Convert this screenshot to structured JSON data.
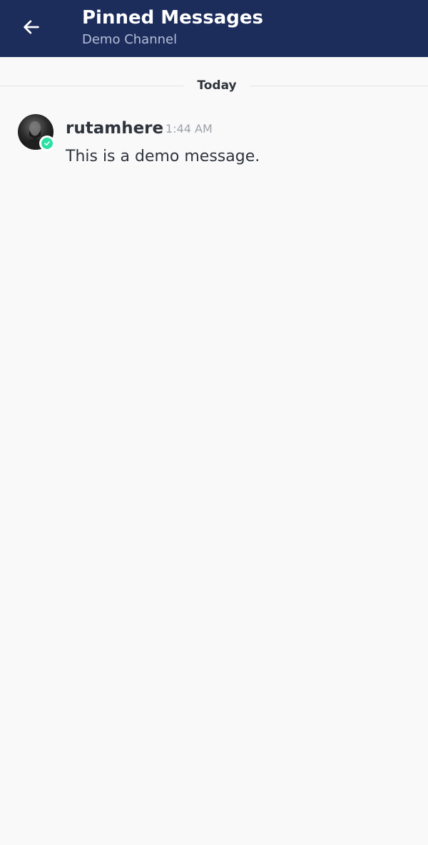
{
  "header": {
    "title": "Pinned Messages",
    "subtitle": "Demo Channel",
    "back_icon": "arrow-left-icon",
    "background_color": "#1c2d5c"
  },
  "divider": {
    "label": "Today"
  },
  "messages": [
    {
      "username": "rutamhere",
      "time": "1:44 AM",
      "text": "This is a demo message.",
      "status": "online",
      "status_color": "#2de0a5",
      "status_icon": "check-icon"
    }
  ]
}
